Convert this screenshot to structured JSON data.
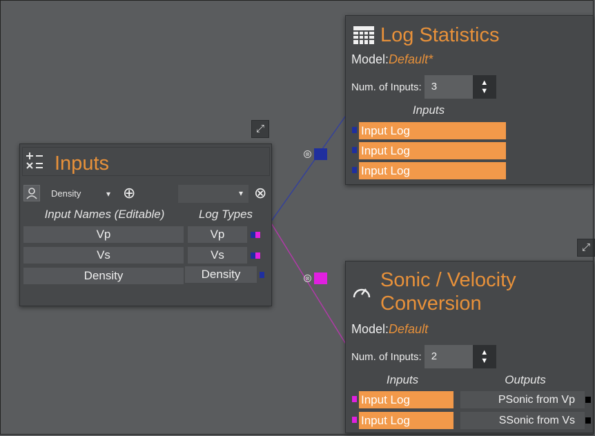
{
  "colors": {
    "canvas": "#5a5c5e",
    "node_bg": "#46484a",
    "accent_orange": "#e8913a",
    "input_row_orange": "#f2994a",
    "port_blue": "#1f2f9e",
    "port_magenta": "#e020e0",
    "wire_blue": "#34409a",
    "wire_magenta": "#b13aa8"
  },
  "inputs_node": {
    "title": "Inputs",
    "icon": "calculator-icon",
    "expand_icon": "expand-arrows-icon",
    "toolbar": {
      "person_icon": "person-icon",
      "dropdown_value": "Density",
      "dropdown_arrow": "▾",
      "add_icon": "⊕",
      "second_dropdown_value": "",
      "second_dropdown_arrow": "▾",
      "remove_icon": "⊗"
    },
    "col_names": "Input Names (Editable)",
    "col_types": "Log Types",
    "rows": [
      {
        "name": "Vp",
        "type": "Vp",
        "ports": [
          "blue",
          "magenta"
        ]
      },
      {
        "name": "Vs",
        "type": "Vs",
        "ports": [
          "blue",
          "magenta"
        ]
      },
      {
        "name": "Density",
        "type": "Density",
        "ports": [
          "blue"
        ]
      }
    ]
  },
  "log_stats_node": {
    "title": "Log Statistics",
    "icon": "grid-table-icon",
    "model_label": "Model:",
    "model_value": "Default*",
    "num_inputs_label": "Num. of Inputs:",
    "num_inputs_value": "3",
    "stepper_up": "▲",
    "stepper_down": "▼",
    "inputs_header": "Inputs",
    "input_rows": [
      "Input Log",
      "Input Log",
      "Input Log"
    ]
  },
  "sonic_node": {
    "title_line1": "Sonic / Velocity",
    "title_line2": "Conversion",
    "icon": "speedometer-icon",
    "expand_icon": "expand-arrows-icon",
    "model_label": "Model:",
    "model_value": "Default",
    "num_inputs_label": "Num. of Inputs:",
    "num_inputs_value": "2",
    "stepper_up": "▲",
    "stepper_down": "▼",
    "inputs_header": "Inputs",
    "outputs_header": "Outputs",
    "input_rows": [
      "Input Log",
      "Input Log"
    ],
    "output_rows": [
      "PSonic from Vp",
      "SSonic from Vs"
    ]
  },
  "connectors": {
    "ring_glyph": "⊗",
    "blue_link": "connector-blue",
    "magenta_link": "connector-magenta"
  }
}
